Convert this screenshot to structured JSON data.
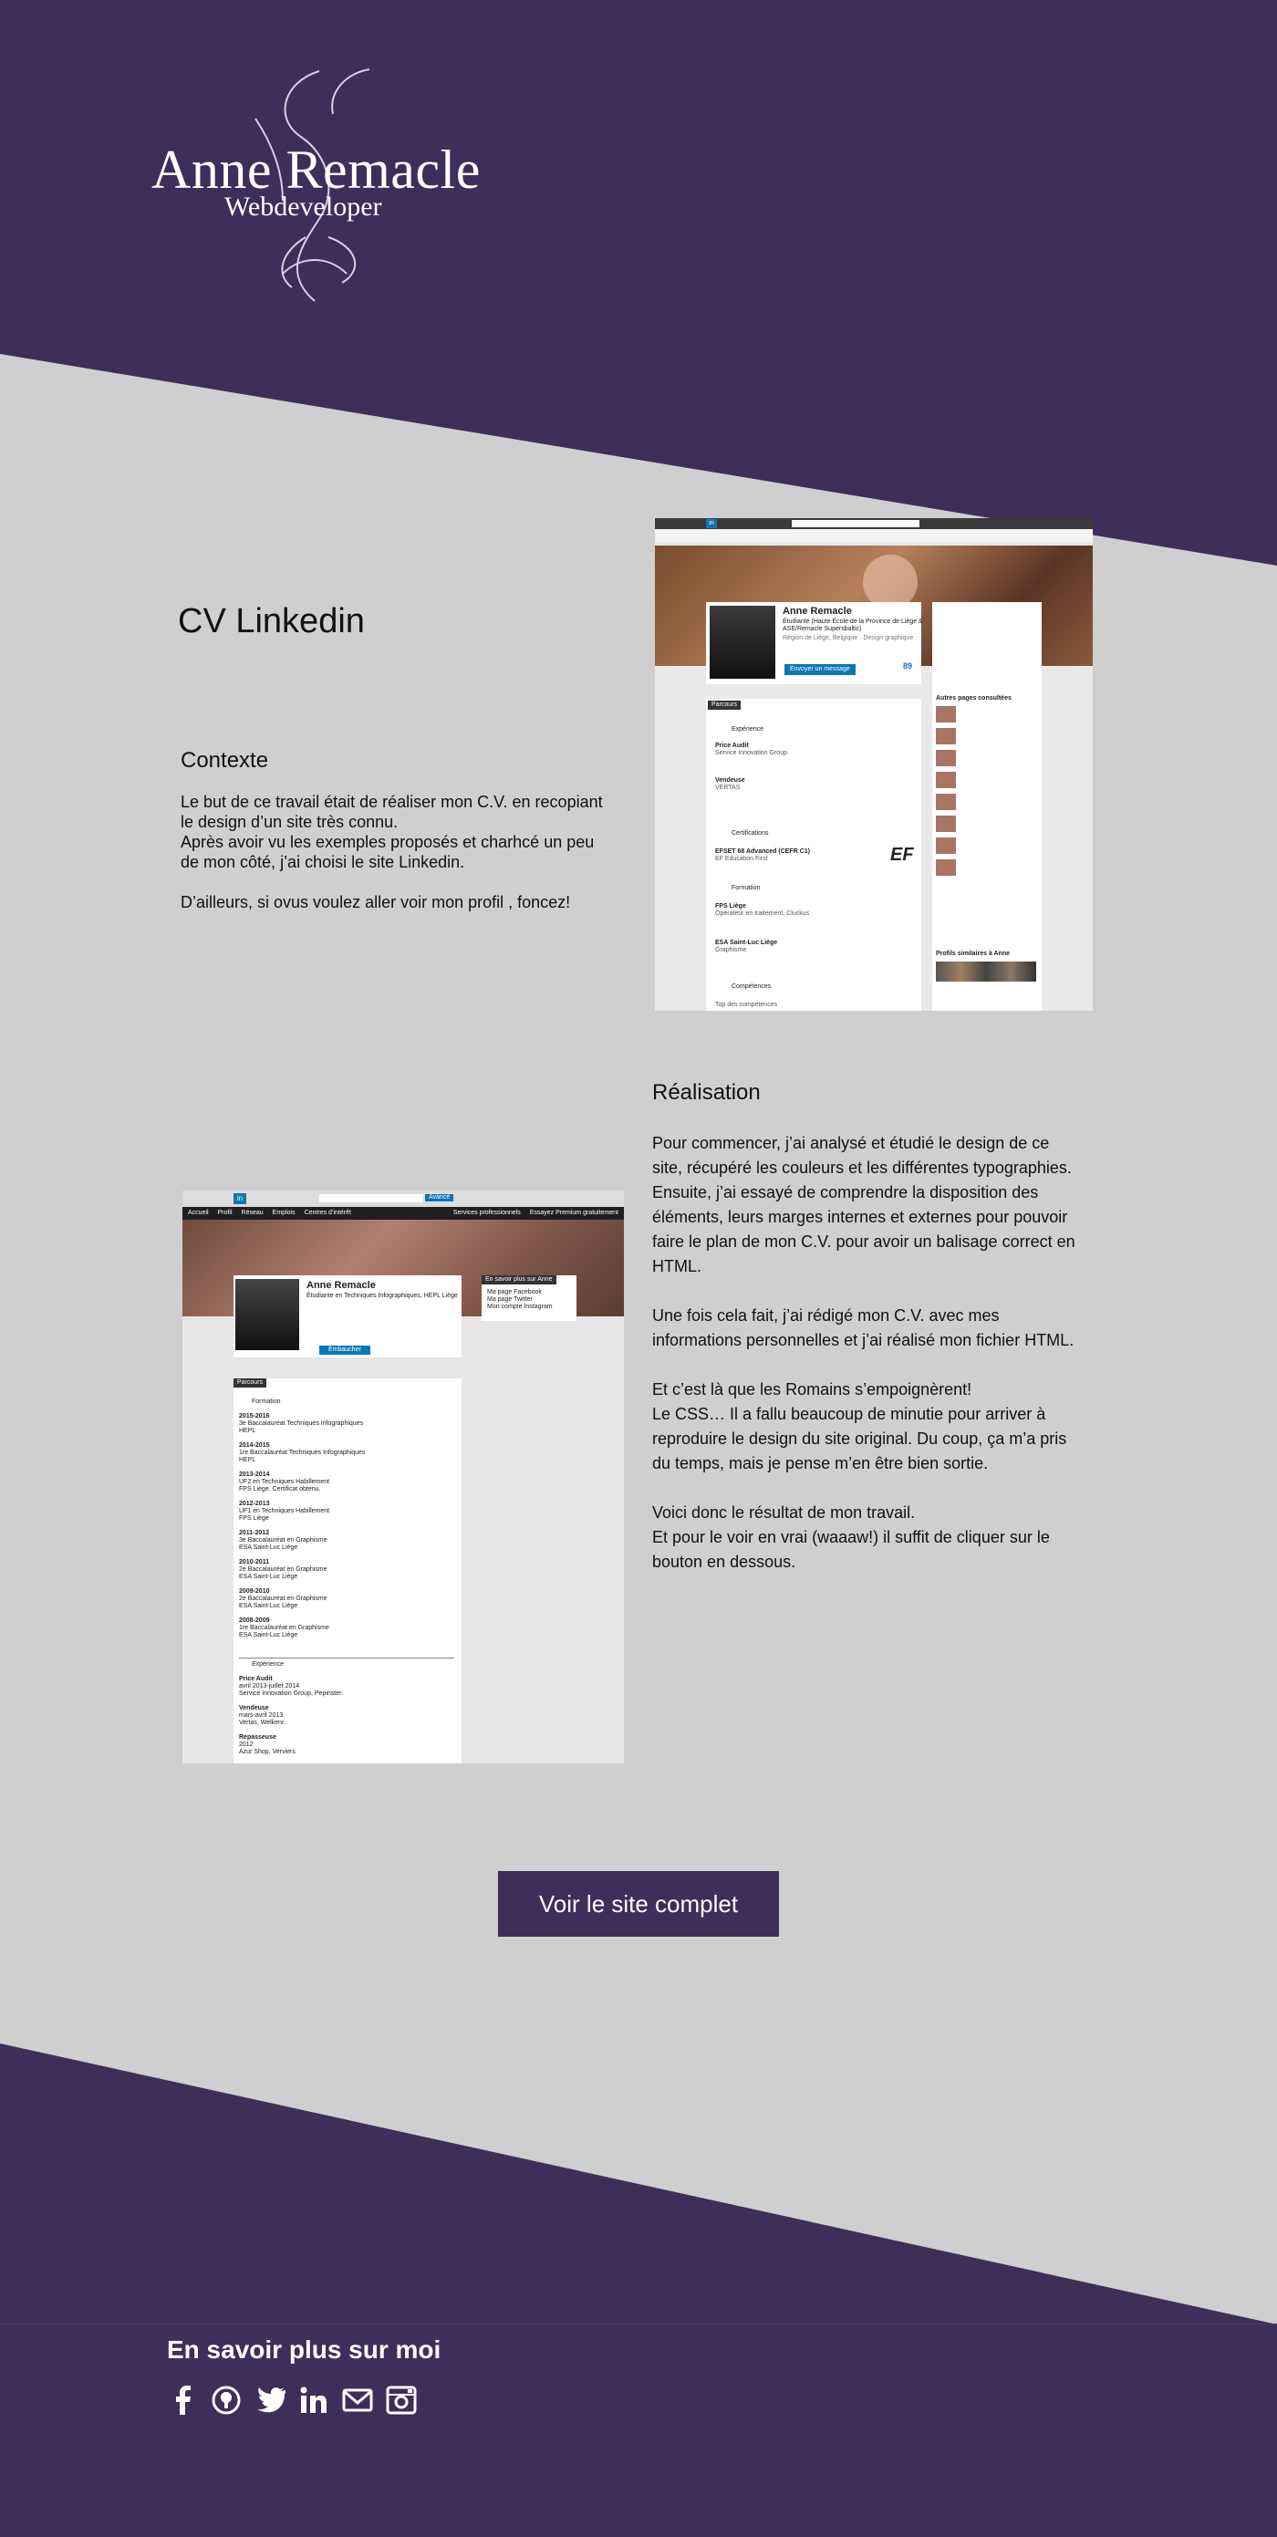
{
  "colors": {
    "dark_purple": "#3d2f59",
    "grey_bg": "#cfcfcf",
    "white": "#ffffff"
  },
  "header": {
    "logo_name": "Anne Remacle",
    "logo_subtitle": "Webdeveloper"
  },
  "project": {
    "title": "CV Linkedin",
    "context_heading": "Contexte",
    "context_text": "Le but de ce travail était de réaliser mon C.V. en recopiant\nle design d’un site très connu.\nAprès avoir vu les exemples proposés et charhcé un peu\nde mon côté, j’ai choisi le site Linkedin.\n\nD’ailleurs, si ovus voulez aller voir mon profil , foncez!",
    "realisation_heading": "Réalisation",
    "realisation_text": "Pour commencer, j’ai analysé et étudié le design de ce\nsite, récupéré les couleurs et les différentes typographies.\nEnsuite, j’ai essayé de comprendre la disposition des\néléments, leurs marges internes et externes pour pouvoir\nfaire le plan de mon C.V. pour avoir un balisage correct en\nHTML.\n\nUne fois cela fait, j’ai rédigé mon C.V. avec mes\ninformations personnelles et j’ai réalisé mon fichier HTML.\n\nEt c’est là que les Romains s’empoignèrent!\nLe CSS… Il a fallu beaucoup de minutie pour arriver à\nreproduire le design du site original. Du coup, ça m’a pris\ndu temps, mais je pense m’en être bien sortie.\n\nVoici donc le résultat de mon travail.\nEt pour le voir en vrai (waaaw!) il suffit de cliquer sur le\nbouton en dessous.",
    "cta_label": "Voir le site complet"
  },
  "screenshot_original": {
    "name": "Anne Remacle",
    "headline": "Étudiante (Haute École de la Province de Liège &",
    "headline2": "ASE/Remacle Supersbaltic)",
    "location": "Région de Liège, Belgique · Design graphique",
    "button": "Envoyer un message",
    "connections": "89",
    "section_parcours": "Parcours",
    "experience_heading": "Expérience",
    "exp1_title": "Price Audit",
    "exp1_org": "Service Innovation Group",
    "exp2_title": "Vendeuse",
    "exp2_org": "VERTAS",
    "cert_heading": "Certifications",
    "cert1": "EFSET 68 Advanced (CEFR C1)",
    "cert1_org": "EF Education First",
    "cert_logo": "EF",
    "formation_heading": "Formation",
    "form1": "FPS Liège",
    "form1_sub": "Opérateur en traitement, Cluckus",
    "form2": "ESA Saint-Luc Liège",
    "form2_sub": "Graphisme",
    "skills_heading": "Compétences",
    "skills_sub": "Top des compétences",
    "sidebar_heading": "Autres pages consultées",
    "sidebar_heading2": "Profils similaires à Anne"
  },
  "screenshot_result": {
    "nav": [
      "Accueil",
      "Profil",
      "Réseau",
      "Emplois",
      "Centres d’intérêt"
    ],
    "nav_right": [
      "Services professionnels",
      "Essayez Premium gratuitement"
    ],
    "search_button": "Avancé",
    "name": "Anne Remacle",
    "headline": "Étudiante en Techniques Infographiques, HEPL Liège",
    "action_button": "Embaucher",
    "more_heading": "En savoir plus sur Anne",
    "more_links": [
      "Ma page Facebook",
      "Ma page Twitter",
      "Mon compte Instagram"
    ],
    "section_parcours": "Parcours",
    "formation_heading": "Formation",
    "formation": [
      {
        "year": "2015-2016",
        "line1": "3e Baccalauréat Techniques Infographiques",
        "line2": "HEPL"
      },
      {
        "year": "2014-2015",
        "line1": "1re Baccalauréat Techniques Infographiques",
        "line2": "HEPL"
      },
      {
        "year": "2013-2014",
        "line1": "UF2 en Techniques Habillement",
        "line2": "FPS Liège. Certificat obtenu."
      },
      {
        "year": "2012-2013",
        "line1": "UF1 en Techniques Habillement",
        "line2": "FPS Liège"
      },
      {
        "year": "2011-2012",
        "line1": "3e Baccalauréat en Graphisme",
        "line2": "ESA Saint-Luc Liège"
      },
      {
        "year": "2010-2011",
        "line1": "2e Baccalauréat en Graphisme",
        "line2": "ESA Saint-Luc Liège"
      },
      {
        "year": "2009-2010",
        "line1": "2e Baccalauréat en Graphisme",
        "line2": "ESA Saint-Luc Liège"
      },
      {
        "year": "2008-2009",
        "line1": "1re Baccalauréat en Graphisme",
        "line2": "ESA Saint-Luc Liège"
      }
    ],
    "experience_heading": "Expérience",
    "experience": [
      {
        "title": "Price Audit",
        "line1": "avril 2013-juillet 2014",
        "line2": "Service Innovation Group, Pepinster."
      },
      {
        "title": "Vendeuse",
        "line1": "mars-avril 2013",
        "line2": "Vertas, Welkenr."
      },
      {
        "title": "Repasseuse",
        "line1": "2012",
        "line2": "Azur Shop, Verviers"
      }
    ]
  },
  "footer": {
    "title": "En savoir plus sur moi",
    "socials": [
      "facebook-icon",
      "github-icon",
      "twitter-icon",
      "linkedin-icon",
      "mail-icon",
      "instagram-icon"
    ]
  }
}
